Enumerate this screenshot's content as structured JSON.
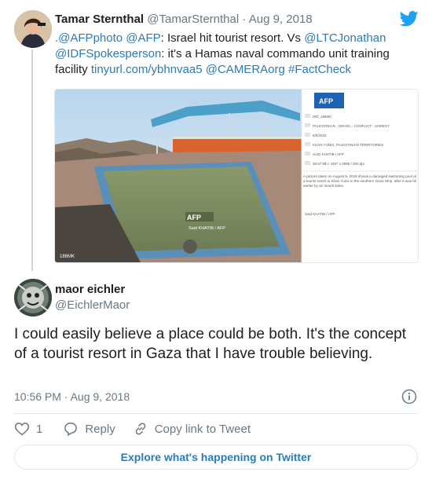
{
  "parent_tweet": {
    "name": "Tamar Sternthal",
    "handle": "@TamarSternthal",
    "separator": " · ",
    "date": "Aug 9, 2018",
    "text_segments": [
      {
        "text": ".@AFPphoto @AFP",
        "link": true
      },
      {
        "text": ": Israel hit tourist resort. Vs ",
        "link": false
      },
      {
        "text": "@LTCJonathan @IDFSpokesperson",
        "link": true
      },
      {
        "text": ": it's a Hamas naval commando unit training facility ",
        "link": false
      },
      {
        "text": "tinyurl.com/ybhnvaa5 @CAMERAorg #FactCheck",
        "link": true
      }
    ],
    "media": {
      "photo_watermark": "AFP",
      "photo_credit": "Said KHATIB / AFP",
      "photo_size_label": "186MK",
      "panel_logo": "AFP",
      "panel_rows": [
        "000_186MK",
        "PALESTINIAN - ISRAEL - CONFLICT - UNREST",
        "8/9/2018",
        "KHAN YUNIS, PALESTINIAN TERRITORIES",
        "SAID KHATIB / AFP",
        "38.57 Mb / 4497 x 2998 / 300 dpi"
      ],
      "caption": "A picture taken on August 9, 2018 shows a damaged swimming pool at a tourist resort in Khan Yunis in the southern Gaza Strip, after it was hit earlier by an Israeli strike.",
      "caption_credit": "Said KHATIB / AFP"
    }
  },
  "reply_tweet": {
    "name": "maor eichler",
    "handle": "@EichlerMaor",
    "text": "I could easily believe a place could be both. It's the concept of a tourist resort in Gaza that I have trouble believing.",
    "timestamp": "10:56 PM · Aug 9, 2018"
  },
  "actions": {
    "like_count": "1",
    "reply_label": "Reply",
    "copy_link_label": "Copy link to Tweet"
  },
  "explore_label": "Explore what's happening on Twitter",
  "icons": {
    "logo": "twitter-bird-icon",
    "info": "info-icon",
    "like": "heart-icon",
    "reply": "reply-bubble-icon",
    "copy": "link-icon"
  },
  "colors": {
    "link": "#2b7bb9",
    "twitter_blue": "#1da1f2",
    "text": "#1c2022",
    "muted": "#697882",
    "border": "#e1e8ed"
  }
}
